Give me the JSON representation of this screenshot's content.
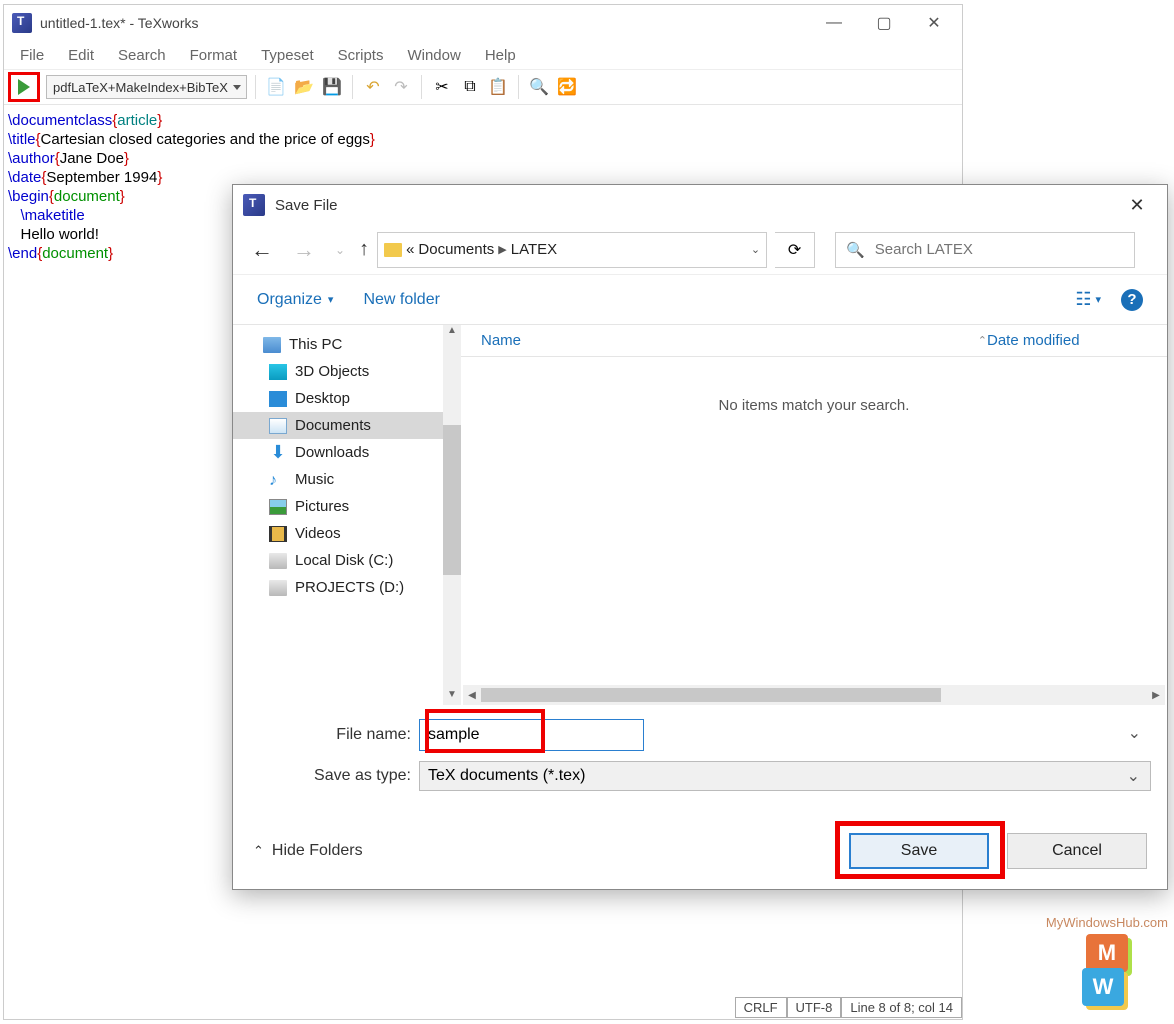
{
  "texworks": {
    "title": "untitled-1.tex* - TeXworks",
    "menus": [
      "File",
      "Edit",
      "Search",
      "Format",
      "Typeset",
      "Scripts",
      "Window",
      "Help"
    ],
    "engine": "pdfLaTeX+MakeIndex+BibTeX",
    "source": {
      "l1_cmd": "\\documentclass",
      "l1_arg": "article",
      "l2_cmd": "\\title",
      "l2_arg": "Cartesian closed categories and the price of eggs",
      "l3_cmd": "\\author",
      "l3_arg": "Jane Doe",
      "l4_cmd": "\\date",
      "l4_arg": "September 1994",
      "l5_cmd": "\\begin",
      "l5_arg": "document",
      "l6_cmd": "   \\maketitle",
      "l7": "   Hello world!",
      "l8_cmd": "\\end",
      "l8_arg": "document"
    },
    "status": {
      "crlf": "CRLF",
      "enc": "UTF-8",
      "pos": "Line 8 of 8; col 14"
    }
  },
  "dialog": {
    "title": "Save File",
    "breadcrumb": {
      "root": "«",
      "seg1": "Documents",
      "seg2": "LATEX"
    },
    "search_placeholder": "Search LATEX",
    "organize": "Organize",
    "new_folder": "New folder",
    "tree": {
      "this_pc": "This PC",
      "objects3d": "3D Objects",
      "desktop": "Desktop",
      "documents": "Documents",
      "downloads": "Downloads",
      "music": "Music",
      "pictures": "Pictures",
      "videos": "Videos",
      "local_c": "Local Disk (C:)",
      "projects_d": "PROJECTS (D:)"
    },
    "columns": {
      "name": "Name",
      "date": "Date modified"
    },
    "empty": "No items match your search.",
    "filename_label": "File name:",
    "filename_value": "sample",
    "type_label": "Save as type:",
    "type_value": "TeX documents (*.tex)",
    "hide_folders": "Hide Folders",
    "save": "Save",
    "cancel": "Cancel"
  },
  "watermark": {
    "text": "MyWindowsHub.com",
    "m": "M",
    "w": "W"
  }
}
